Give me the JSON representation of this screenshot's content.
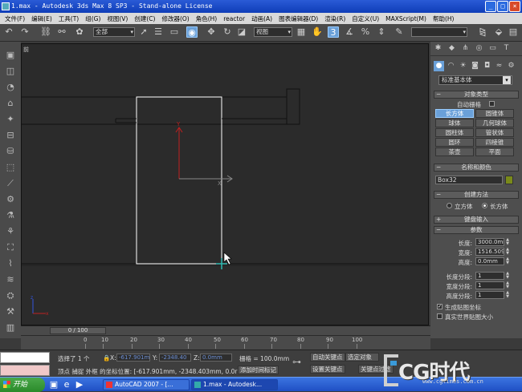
{
  "window": {
    "title": "1.max - Autodesk 3ds Max 8 SP3 - Stand-alone License"
  },
  "menu": [
    "文件(F)",
    "编辑(E)",
    "工具(T)",
    "组(G)",
    "视图(V)",
    "创建(C)",
    "修改器(O)",
    "角色(H)",
    "reactor",
    "动画(A)",
    "图表编辑器(D)",
    "渲染(R)",
    "自定义(U)",
    "MAXScript(M)",
    "帮助(H)"
  ],
  "toolbar": {
    "selection_filter": "全部",
    "ref_coord": "视图",
    "named_selection": ""
  },
  "viewport": {
    "label": "前"
  },
  "command_panel": {
    "category": "标准基本体",
    "object_type": {
      "header": "对象类型",
      "autogrid_label": "自动栅格",
      "buttons": [
        "长方体",
        "圆锥体",
        "球体",
        "几何球体",
        "圆柱体",
        "管状体",
        "圆环",
        "四棱锥",
        "茶壶",
        "平面"
      ],
      "active": "长方体"
    },
    "name_color": {
      "header": "名称和颜色",
      "name": "Box32",
      "color": "#7a8a1a"
    },
    "creation_method": {
      "header": "创建方法",
      "options": [
        "立方体",
        "长方体"
      ],
      "selected": "长方体"
    },
    "keyboard_entry": {
      "header": "键盘输入"
    },
    "params": {
      "header": "参数",
      "fields": [
        {
          "label": "长度:",
          "value": "3000.0mm"
        },
        {
          "label": "宽度:",
          "value": "1516.509"
        },
        {
          "label": "高度:",
          "value": "0.0mm"
        }
      ],
      "segments": [
        {
          "label": "长度分段:",
          "value": "1"
        },
        {
          "label": "宽度分段:",
          "value": "1"
        },
        {
          "label": "高度分段:",
          "value": "1"
        }
      ],
      "gen_mapping": "生成贴图坐标",
      "real_world": "真实世界贴图大小"
    }
  },
  "timeline": {
    "frame": "0 / 100",
    "ticks": [
      "0",
      "10",
      "20",
      "30",
      "40",
      "50",
      "60",
      "70",
      "80",
      "90",
      "100"
    ]
  },
  "status": {
    "selected": "选择了 1 个",
    "x": "-617.901m",
    "y": "-2348.40",
    "z": "0.0mm",
    "grid": "栅格 = 100.0mm",
    "prompt": "顶点 捕捉 外框 的坐标位置: [-617.901mm, -2348.403mm, 0.0r",
    "add_time_tag": "添加时间标记",
    "auto_key": "自动关键点",
    "set_key": "设置关键点",
    "selection_obj": "选定对象",
    "key_filter": "关键点过滤"
  },
  "taskbar": {
    "start": "开始",
    "tasks": [
      "AutoCAD 2007 - [...",
      "1.max - Autodesk..."
    ]
  },
  "watermark": {
    "logo": "CG时代",
    "url": "www.cgtimes.com.cn"
  }
}
